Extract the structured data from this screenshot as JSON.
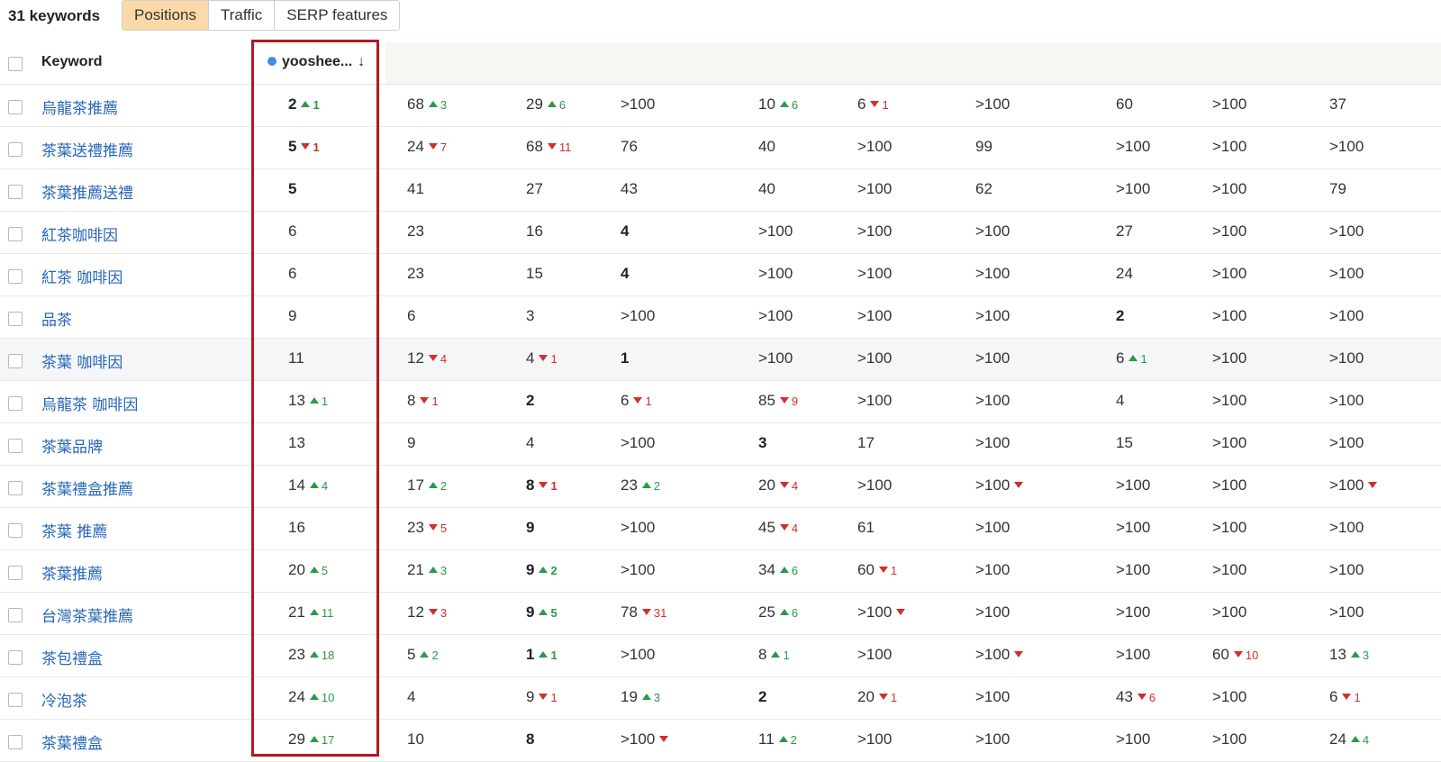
{
  "toolbar": {
    "keyword_count": "31 keywords",
    "tabs": [
      {
        "label": "Positions",
        "active": true
      },
      {
        "label": "Traffic",
        "active": false
      },
      {
        "label": "SERP features",
        "active": false
      }
    ]
  },
  "table": {
    "header": {
      "keyword": "Keyword",
      "domain": "yooshee...",
      "sort_icon": "↓"
    },
    "rows": [
      {
        "keyword": "烏龍茶推薦",
        "cells": [
          {
            "v": "2",
            "b": true,
            "d": "up",
            "c": "1"
          },
          {
            "v": "68",
            "d": "up",
            "c": "3"
          },
          {
            "v": "29",
            "d": "up",
            "c": "6"
          },
          {
            "v": ">100"
          },
          {
            "v": "10",
            "d": "up",
            "c": "6"
          },
          {
            "v": "6",
            "d": "down",
            "c": "1"
          },
          {
            "v": ">100"
          },
          {
            "v": "60"
          },
          {
            "v": ">100"
          },
          {
            "v": "37"
          }
        ]
      },
      {
        "keyword": "茶葉送禮推薦",
        "cells": [
          {
            "v": "5",
            "b": true,
            "d": "down",
            "c": "1"
          },
          {
            "v": "24",
            "d": "down",
            "c": "7"
          },
          {
            "v": "68",
            "d": "down",
            "c": "11"
          },
          {
            "v": "76"
          },
          {
            "v": "40"
          },
          {
            "v": ">100"
          },
          {
            "v": "99"
          },
          {
            "v": ">100"
          },
          {
            "v": ">100"
          },
          {
            "v": ">100"
          }
        ]
      },
      {
        "keyword": "茶葉推薦送禮",
        "cells": [
          {
            "v": "5",
            "b": true
          },
          {
            "v": "41"
          },
          {
            "v": "27"
          },
          {
            "v": "43"
          },
          {
            "v": "40"
          },
          {
            "v": ">100"
          },
          {
            "v": "62"
          },
          {
            "v": ">100"
          },
          {
            "v": ">100"
          },
          {
            "v": "79"
          }
        ]
      },
      {
        "keyword": "紅茶咖啡因",
        "cells": [
          {
            "v": "6"
          },
          {
            "v": "23"
          },
          {
            "v": "16"
          },
          {
            "v": "4",
            "b": true
          },
          {
            "v": ">100"
          },
          {
            "v": ">100"
          },
          {
            "v": ">100"
          },
          {
            "v": "27"
          },
          {
            "v": ">100"
          },
          {
            "v": ">100"
          }
        ]
      },
      {
        "keyword": "紅茶 咖啡因",
        "cells": [
          {
            "v": "6"
          },
          {
            "v": "23"
          },
          {
            "v": "15"
          },
          {
            "v": "4",
            "b": true
          },
          {
            "v": ">100"
          },
          {
            "v": ">100"
          },
          {
            "v": ">100"
          },
          {
            "v": "24"
          },
          {
            "v": ">100"
          },
          {
            "v": ">100"
          }
        ]
      },
      {
        "keyword": "品茶",
        "cells": [
          {
            "v": "9"
          },
          {
            "v": "6"
          },
          {
            "v": "3"
          },
          {
            "v": ">100"
          },
          {
            "v": ">100"
          },
          {
            "v": ">100"
          },
          {
            "v": ">100"
          },
          {
            "v": "2",
            "b": true
          },
          {
            "v": ">100"
          },
          {
            "v": ">100"
          }
        ]
      },
      {
        "keyword": "茶葉 咖啡因",
        "highlight": true,
        "cells": [
          {
            "v": "11"
          },
          {
            "v": "12",
            "d": "down",
            "c": "4"
          },
          {
            "v": "4",
            "d": "down",
            "c": "1"
          },
          {
            "v": "1",
            "b": true
          },
          {
            "v": ">100"
          },
          {
            "v": ">100"
          },
          {
            "v": ">100"
          },
          {
            "v": "6",
            "d": "up",
            "c": "1"
          },
          {
            "v": ">100"
          },
          {
            "v": ">100"
          }
        ]
      },
      {
        "keyword": "烏龍茶 咖啡因",
        "cells": [
          {
            "v": "13",
            "d": "up",
            "c": "1"
          },
          {
            "v": "8",
            "d": "down",
            "c": "1"
          },
          {
            "v": "2",
            "b": true
          },
          {
            "v": "6",
            "d": "down",
            "c": "1"
          },
          {
            "v": "85",
            "d": "down",
            "c": "9"
          },
          {
            "v": ">100"
          },
          {
            "v": ">100"
          },
          {
            "v": "4"
          },
          {
            "v": ">100"
          },
          {
            "v": ">100"
          }
        ]
      },
      {
        "keyword": "茶葉品牌",
        "cells": [
          {
            "v": "13"
          },
          {
            "v": "9"
          },
          {
            "v": "4"
          },
          {
            "v": ">100"
          },
          {
            "v": "3",
            "b": true
          },
          {
            "v": "17"
          },
          {
            "v": ">100"
          },
          {
            "v": "15"
          },
          {
            "v": ">100"
          },
          {
            "v": ">100"
          }
        ]
      },
      {
        "keyword": "茶葉禮盒推薦",
        "cells": [
          {
            "v": "14",
            "d": "up",
            "c": "4"
          },
          {
            "v": "17",
            "d": "up",
            "c": "2"
          },
          {
            "v": "8",
            "b": true,
            "d": "down",
            "c": "1"
          },
          {
            "v": "23",
            "d": "up",
            "c": "2"
          },
          {
            "v": "20",
            "d": "down",
            "c": "4"
          },
          {
            "v": ">100"
          },
          {
            "v": ">100",
            "d": "down",
            "c": ""
          },
          {
            "v": ">100"
          },
          {
            "v": ">100"
          },
          {
            "v": ">100",
            "d": "down",
            "c": ""
          }
        ]
      },
      {
        "keyword": "茶葉 推薦",
        "cells": [
          {
            "v": "16"
          },
          {
            "v": "23",
            "d": "down",
            "c": "5"
          },
          {
            "v": "9",
            "b": true
          },
          {
            "v": ">100"
          },
          {
            "v": "45",
            "d": "down",
            "c": "4"
          },
          {
            "v": "61"
          },
          {
            "v": ">100"
          },
          {
            "v": ">100"
          },
          {
            "v": ">100"
          },
          {
            "v": ">100"
          }
        ]
      },
      {
        "keyword": "茶葉推薦",
        "cells": [
          {
            "v": "20",
            "d": "up",
            "c": "5"
          },
          {
            "v": "21",
            "d": "up",
            "c": "3"
          },
          {
            "v": "9",
            "b": true,
            "d": "up",
            "c": "2"
          },
          {
            "v": ">100"
          },
          {
            "v": "34",
            "d": "up",
            "c": "6"
          },
          {
            "v": "60",
            "d": "down",
            "c": "1"
          },
          {
            "v": ">100"
          },
          {
            "v": ">100"
          },
          {
            "v": ">100"
          },
          {
            "v": ">100"
          }
        ]
      },
      {
        "keyword": "台灣茶葉推薦",
        "cells": [
          {
            "v": "21",
            "d": "up",
            "c": "11"
          },
          {
            "v": "12",
            "d": "down",
            "c": "3"
          },
          {
            "v": "9",
            "b": true,
            "d": "up",
            "c": "5"
          },
          {
            "v": "78",
            "d": "down",
            "c": "31"
          },
          {
            "v": "25",
            "d": "up",
            "c": "6"
          },
          {
            "v": ">100",
            "d": "down",
            "c": ""
          },
          {
            "v": ">100"
          },
          {
            "v": ">100"
          },
          {
            "v": ">100"
          },
          {
            "v": ">100"
          }
        ]
      },
      {
        "keyword": "茶包禮盒",
        "cells": [
          {
            "v": "23",
            "d": "up",
            "c": "18"
          },
          {
            "v": "5",
            "d": "up",
            "c": "2"
          },
          {
            "v": "1",
            "b": true,
            "d": "up",
            "c": "1"
          },
          {
            "v": ">100"
          },
          {
            "v": "8",
            "d": "up",
            "c": "1"
          },
          {
            "v": ">100"
          },
          {
            "v": ">100",
            "d": "down",
            "c": ""
          },
          {
            "v": ">100"
          },
          {
            "v": "60",
            "d": "down",
            "c": "10"
          },
          {
            "v": "13",
            "d": "up",
            "c": "3"
          }
        ]
      },
      {
        "keyword": "冷泡茶",
        "cells": [
          {
            "v": "24",
            "d": "up",
            "c": "10"
          },
          {
            "v": "4"
          },
          {
            "v": "9",
            "d": "down",
            "c": "1"
          },
          {
            "v": "19",
            "d": "up",
            "c": "3"
          },
          {
            "v": "2",
            "b": true
          },
          {
            "v": "20",
            "d": "down",
            "c": "1"
          },
          {
            "v": ">100"
          },
          {
            "v": "43",
            "d": "down",
            "c": "6"
          },
          {
            "v": ">100"
          },
          {
            "v": "6",
            "d": "down",
            "c": "1"
          }
        ]
      },
      {
        "keyword": "茶葉禮盒",
        "cells": [
          {
            "v": "29",
            "d": "up",
            "c": "17"
          },
          {
            "v": "10"
          },
          {
            "v": "8",
            "b": true
          },
          {
            "v": ">100",
            "d": "down",
            "c": ""
          },
          {
            "v": "11",
            "d": "up",
            "c": "2"
          },
          {
            "v": ">100"
          },
          {
            "v": ">100"
          },
          {
            "v": ">100"
          },
          {
            "v": ">100"
          },
          {
            "v": "24",
            "d": "up",
            "c": "4"
          }
        ]
      }
    ]
  },
  "colors": {
    "accent_tab": "#fcd9a8",
    "link": "#2767b8",
    "up": "#2a9a48",
    "down": "#d0302a",
    "highlight_box": "#b01a1f",
    "domain_dot": "#3d8de0"
  }
}
